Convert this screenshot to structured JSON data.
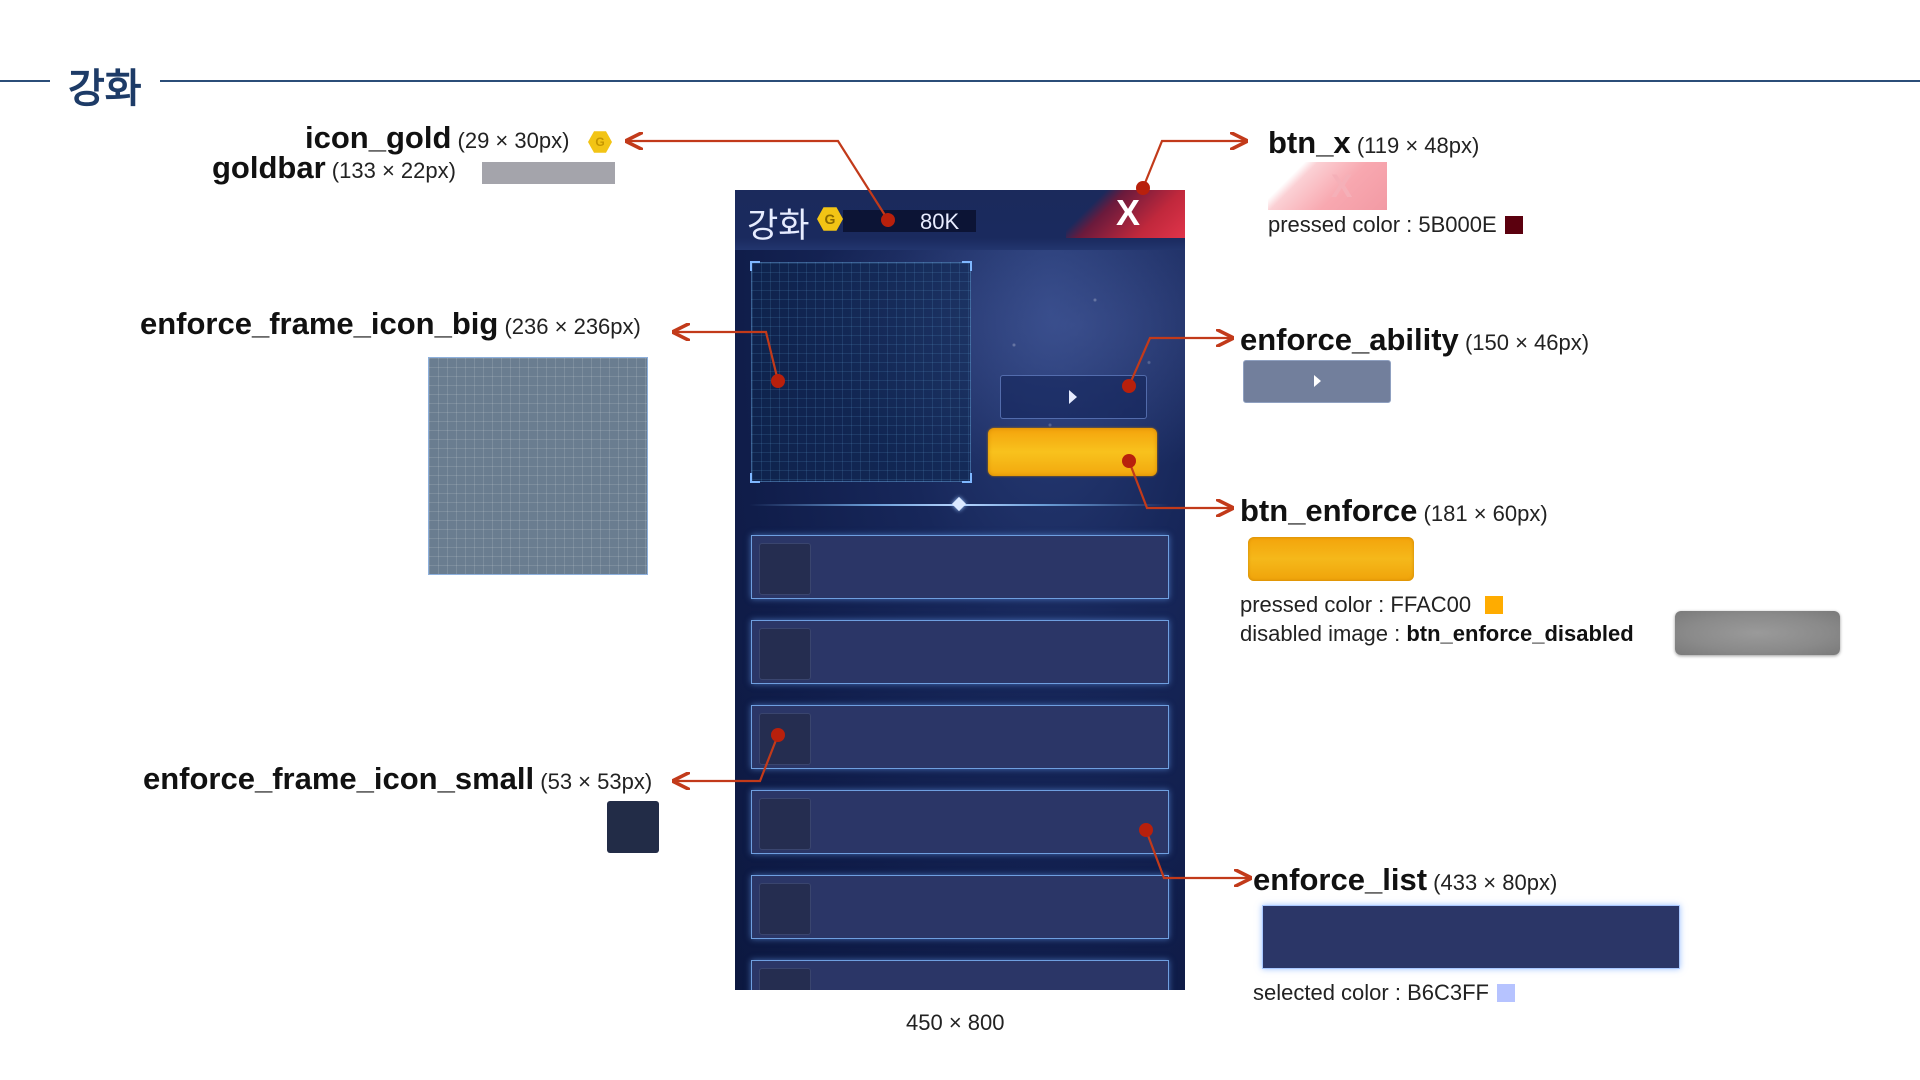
{
  "section": {
    "title": "강화"
  },
  "labels": {
    "icon_gold": {
      "name": "icon_gold",
      "size": "(29 × 30px)"
    },
    "goldbar": {
      "name": "goldbar",
      "size": "(133 × 22px)"
    },
    "enforce_frame_icon_big": {
      "name": "enforce_frame_icon_big",
      "size": "(236 × 236px)"
    },
    "enforce_frame_icon_small": {
      "name": "enforce_frame_icon_small",
      "size": "(53 × 53px)"
    },
    "btn_x": {
      "name": "btn_x",
      "size": "(119 × 48px)",
      "note": "pressed color : 5B000E",
      "swatch": "#5B000E"
    },
    "enforce_ability": {
      "name": "enforce_ability",
      "size": "(150 × 46px)"
    },
    "btn_enforce": {
      "name": "btn_enforce",
      "size": "(181 × 60px)",
      "note": "pressed color : FFAC00",
      "swatch": "#FFAC00",
      "disabled_prefix": "disabled image : ",
      "disabled_name": "btn_enforce_disabled"
    },
    "enforce_list": {
      "name": "enforce_list",
      "size": "(433 × 80px)",
      "note": "selected color : B6C3FF",
      "swatch": "#B6C3FF"
    }
  },
  "game": {
    "title": "강화",
    "gold_icon_letter": "G",
    "gold_amount": "80K",
    "close_glyph": "X",
    "list_count": 6
  },
  "canvas_size": "450 × 800",
  "colors": {
    "header": "#1d3b67",
    "annotation": "#c23a1a",
    "dot": "#b8200c"
  }
}
